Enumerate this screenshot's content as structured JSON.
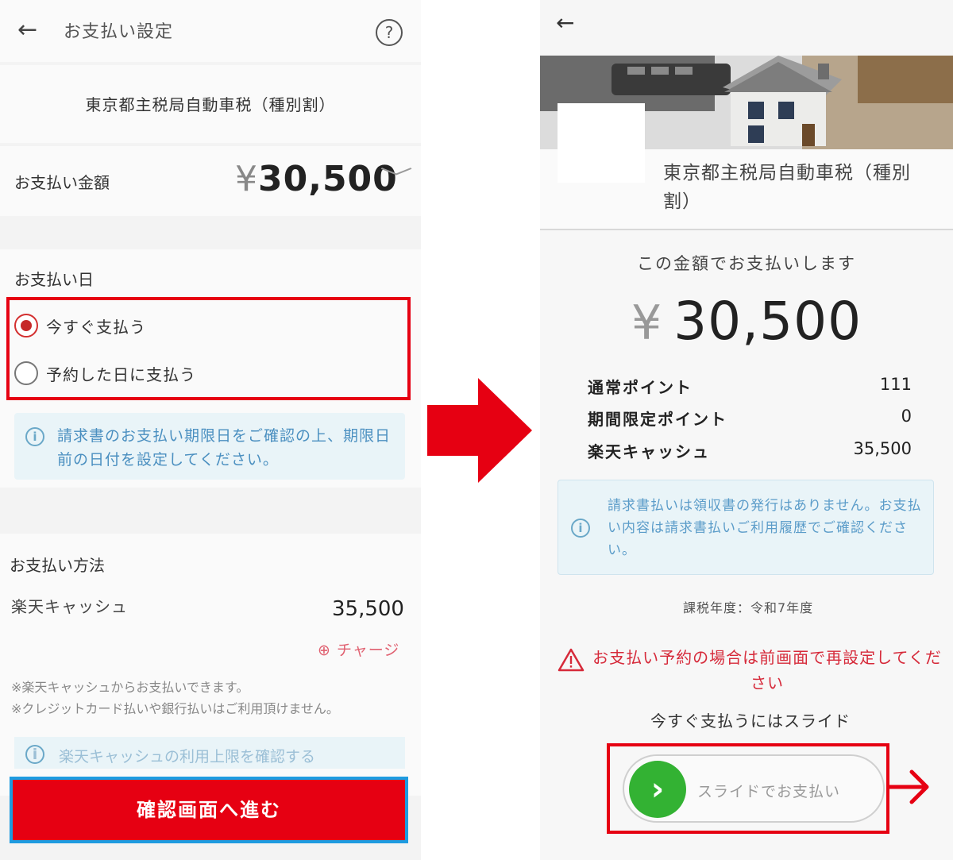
{
  "left": {
    "header": {
      "back_glyph": "←",
      "title": "お支払い設定",
      "help_glyph": "?"
    },
    "biller": "東京都主税局自動車税（種別割）",
    "amount": {
      "label": "お支払い金額",
      "yen": "¥",
      "value": "30,500",
      "chevron": "﹀"
    },
    "date": {
      "label": "お支払い日",
      "options": [
        {
          "label": "今すぐ支払う",
          "selected": true
        },
        {
          "label": "予約した日に支払う",
          "selected": false
        }
      ],
      "info_icon": "i",
      "info": "請求書のお支払い期限日をご確認の上、期限日前の日付を設定してください。"
    },
    "method": {
      "label": "お支払い方法",
      "cash_label": "楽天キャッシュ",
      "cash_value": "35,500",
      "charge": "⊕ チャージ",
      "notes": [
        "※楽天キャッシュからお支払いできます。",
        "※クレジットカード払いや銀行払いはご利用頂けません。"
      ],
      "partial_link": "楽天キャッシュの利用上限を確認する"
    },
    "submit": "確認画面へ進む"
  },
  "right": {
    "back_glyph": "←",
    "biller": "東京都主税局自動車税（種別割）",
    "lead": "この金額でお支払いします",
    "amount": {
      "yen": "¥",
      "value": "30,500"
    },
    "points": [
      {
        "label": "通常ポイント",
        "value": "111"
      },
      {
        "label": "期間限定ポイント",
        "value": "0"
      },
      {
        "label": "楽天キャッシュ",
        "value": "35,500"
      }
    ],
    "info_icon": "i",
    "info": "請求書払いは領収書の発行はありません。お支払い内容は請求書払いご利用履歴でご確認ください。",
    "tax_year": "課税年度：令和7年度",
    "warning": "お支払い予約の場合は前画面で再設定してください",
    "slide_lead": "今すぐ支払うにはスライド",
    "slide_chevron": "›",
    "slide_label": "スライドでお支払い"
  },
  "colors": {
    "accent_red": "#e60012",
    "slider_green": "#33b233",
    "info_blue": "#4a8fc0",
    "warning_red": "#d62a3a"
  },
  "icons": [
    "back-arrow-icon",
    "help-icon",
    "chevron-down-icon",
    "info-icon",
    "warning-icon",
    "chevron-right-icon",
    "red-arrow-icon"
  ]
}
